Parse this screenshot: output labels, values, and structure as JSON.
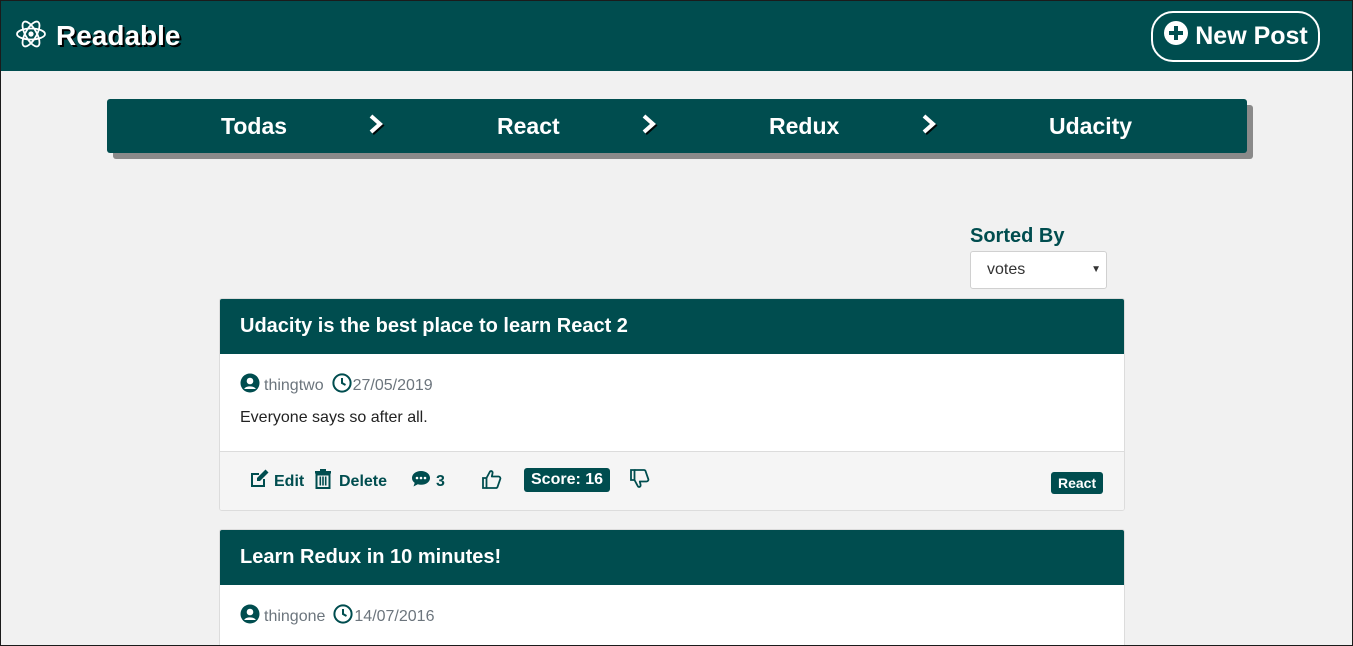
{
  "header": {
    "app_title": "Readable",
    "logo_icon": "react-atom-icon",
    "new_post_label": "New Post",
    "new_post_icon": "plus-circle-icon"
  },
  "categories": [
    {
      "label": "Todas"
    },
    {
      "label": "React"
    },
    {
      "label": "Redux"
    },
    {
      "label": "Udacity"
    }
  ],
  "sort": {
    "label": "Sorted By",
    "selected": "votes"
  },
  "posts": [
    {
      "title": "Udacity is the best place to learn React 2",
      "author": "thingtwo",
      "date": "27/05/2019",
      "body": "Everyone says so after all.",
      "edit_label": "Edit",
      "delete_label": "Delete",
      "comments": "3",
      "score_label": "Score: 16",
      "category": "React"
    },
    {
      "title": "Learn Redux in 10 minutes!",
      "author": "thingone",
      "date": "14/07/2016"
    }
  ],
  "colors": {
    "primary": "#004d4f",
    "background": "#f1f1f1",
    "muted_text": "#6c757d"
  }
}
